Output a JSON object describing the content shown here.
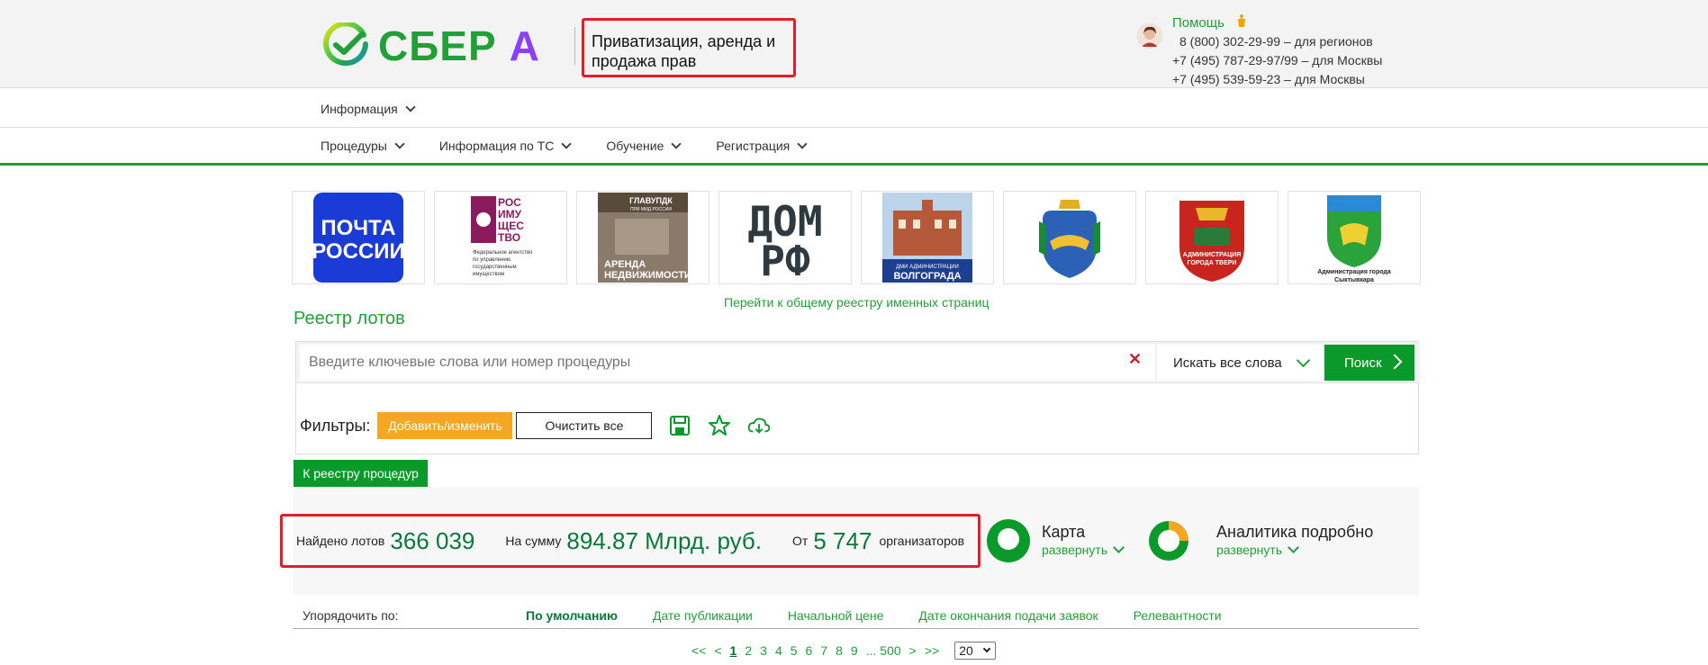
{
  "header": {
    "logo_text": "СБЕР",
    "logo_letter": "А",
    "product_title": "Приватизация, аренда и продажа прав",
    "help_label": "Помощь",
    "phones": [
      "8 (800) 302-29-99 – для регионов",
      "+7 (495) 787-29-97/99 – для Москвы",
      "+7 (495) 539-59-23 – для Москвы"
    ]
  },
  "nav_top": [
    {
      "label": "Информация"
    }
  ],
  "nav_main": [
    {
      "label": "Процедуры"
    },
    {
      "label": "Информация по ТС"
    },
    {
      "label": "Обучение"
    },
    {
      "label": "Регистрация"
    }
  ],
  "partner_logos": {
    "pochta": [
      "ПОЧТА",
      "РОССИИ"
    ],
    "rosim": [
      "РОС",
      "ИМУ",
      "ЩЕС",
      "ТВО"
    ],
    "rosim_caption": [
      "Федеральное агентство",
      "по управлению",
      "государственным",
      "имуществом"
    ],
    "glavupdk": [
      "ГЛАВУПДК",
      "ПРИ МИД РОССИИ"
    ],
    "glavupdk_caption": [
      "АРЕНДА",
      "НЕДВИЖИМОСТИ"
    ],
    "domrf": [
      "ДОМ",
      "РФ"
    ],
    "volgograd": [
      "ДМИ АДМИНИСТРАЦИИ",
      "ВОЛГОГРАДА"
    ],
    "tver": [
      "АДМИНИСТРАЦИЯ",
      "ГОРОДА ТВЕРИ"
    ],
    "syktyvkar": [
      "Администрация города",
      "Сыктывкара"
    ]
  },
  "registry_link": "Перейти к общему реестру именных страниц",
  "registry_title": "Реестр лотов",
  "search": {
    "placeholder": "Введите ключевые слова или номер процедуры",
    "mode": "Искать все слова",
    "button": "Поиск"
  },
  "filters": {
    "label": "Фильтры:",
    "add": "Добавить/изменить",
    "clear": "Очистить все"
  },
  "proc_button": "К реестру процедур",
  "stats": {
    "found_label": "Найдено лотов",
    "found_value": "366 039",
    "sum_label": "На сумму",
    "sum_value": "894.87 Млрд. руб.",
    "org_label": "От",
    "org_value": "5 747",
    "org_after": "организаторов"
  },
  "map": {
    "title": "Карта",
    "expand": "развернуть"
  },
  "analytics": {
    "title": "Аналитика подробно",
    "expand": "развернуть"
  },
  "sort": {
    "label": "Упорядочить по:",
    "options": [
      "По умолчанию",
      "Дате публикации",
      "Начальной цене",
      "Дате окончания подачи заявок",
      "Релевантности"
    ]
  },
  "pager": {
    "items": [
      "<<",
      "<",
      "1",
      "2",
      "3",
      "4",
      "5",
      "6",
      "7",
      "8",
      "9",
      "... 500",
      ">",
      ">>"
    ],
    "page_size": "20"
  },
  "colors": {
    "brand_green": "#21a038",
    "button_green": "#0a9a2a",
    "accent_orange": "#f5a623",
    "highlight_red": "#e31e24",
    "logo_violet": "#8a3ffc"
  }
}
